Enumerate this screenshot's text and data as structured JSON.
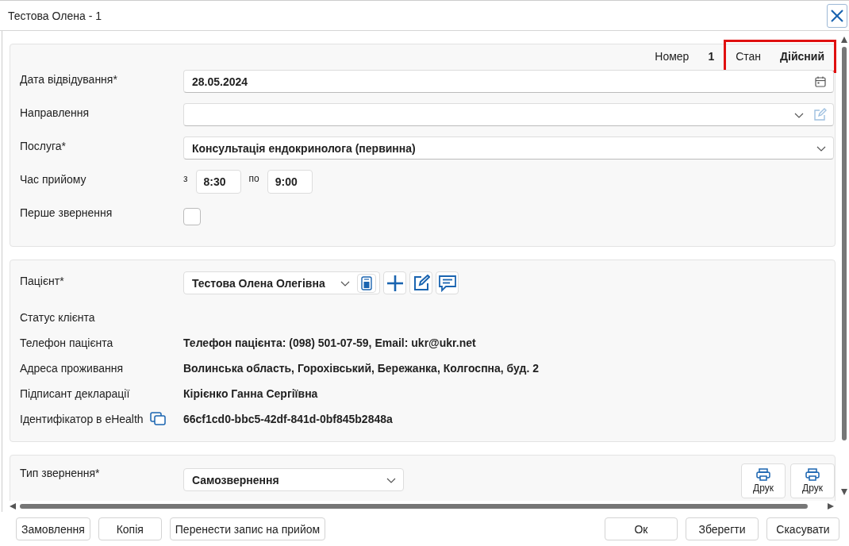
{
  "window": {
    "title": "Тестова Олена - 1"
  },
  "header": {
    "number_label": "Номер",
    "number": "1",
    "state_label": "Стан",
    "state": "Дійсний",
    "highlighted": true
  },
  "visit": {
    "date": {
      "label": "Дата відвідування*",
      "value": "28.05.2024"
    },
    "referral": {
      "label": "Направлення"
    },
    "service": {
      "label": "Послуга*",
      "value": "Консультація ендокринолога (первинна)"
    },
    "time": {
      "label": "Час прийому",
      "from_label": "з",
      "from": "8:30",
      "to_label": "по",
      "to": "9:00"
    },
    "first_visit": {
      "label": "Перше звернення",
      "checked": false
    }
  },
  "patient": {
    "label": "Пацієнт*",
    "value": "Тестова Олена Олегівна",
    "rows": [
      {
        "kind": "text",
        "label": "Статус клієнта"
      },
      {
        "kind": "text",
        "label": "Телефон пацієнта",
        "value": "Телефон пацієнта: (098) 501-07-59, Email: ukr@ukr.net"
      },
      {
        "kind": "text",
        "label": "Адреса проживання",
        "value": "Волинська область, Горохівський, Бережанка, Колгоспна, буд. 2"
      },
      {
        "kind": "text",
        "label": "Підписант декларації",
        "value": "Кірієнко Ганна Сергіївна"
      },
      {
        "kind": "id",
        "label": "Ідентифікатор в eHealth",
        "value": "66cf1cd0-bbc5-42df-841d-0bf845b2848a"
      }
    ]
  },
  "appeal": {
    "label": "Тип звернення*",
    "value": "Самозвернення",
    "print_buttons": [
      "Друк",
      "Друк"
    ]
  },
  "footer": {
    "left_buttons": [
      "Замовлення",
      "Копія",
      "Перенести запис на прийом"
    ],
    "right_buttons": [
      "Ок",
      "Зберегти",
      "Скасувати"
    ]
  }
}
